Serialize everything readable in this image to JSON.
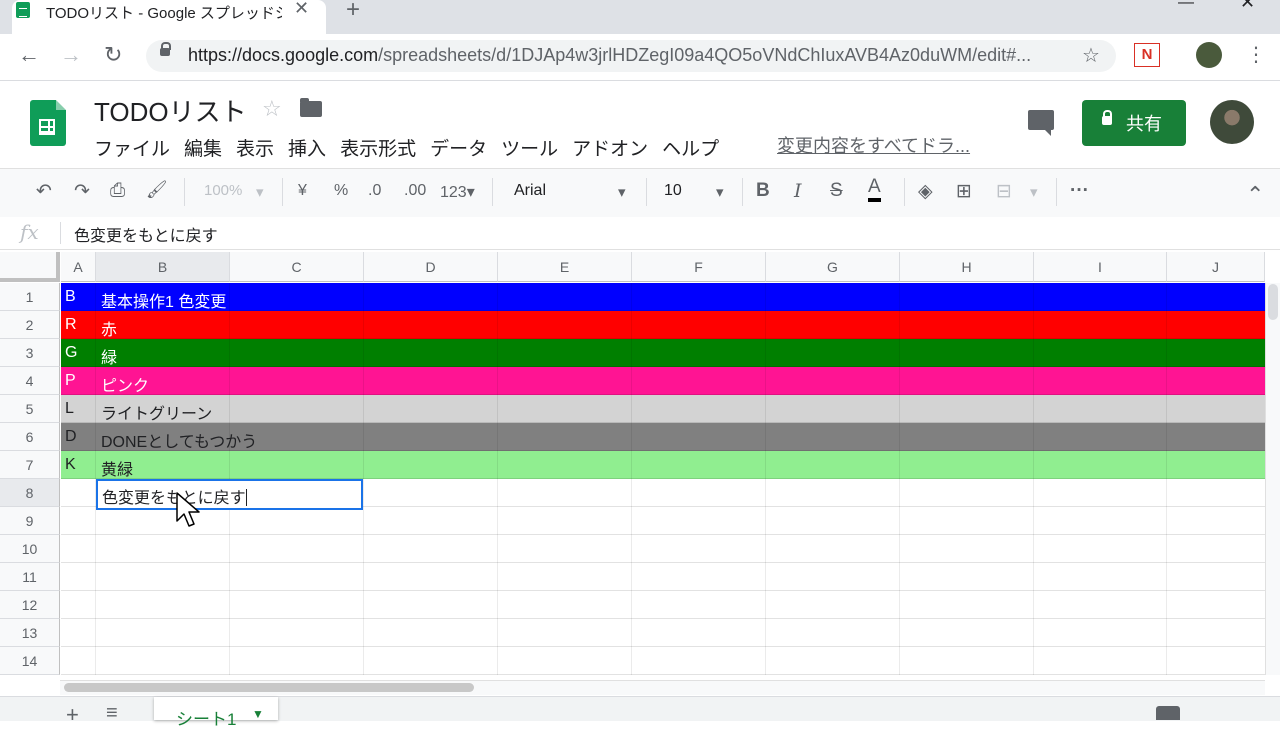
{
  "browser": {
    "tab_title": "TODOリスト - Google スプレッドシー",
    "tab_close": "✕",
    "new_tab": "+",
    "window_minimize": "—",
    "window_close": "✕",
    "back": "←",
    "forward": "→",
    "reload": "↻",
    "url_host": "https://docs.google.com",
    "url_path": "/spreadsheets/d/1DJAp4w3jrlHDZegI09a4QO5oVNdChIuxAVB4Az0duWM/edit#...",
    "star": "☆",
    "extension_label": "N",
    "menu": "⋮"
  },
  "doc": {
    "title": "TODOリスト",
    "star": "☆",
    "menus": [
      "ファイル",
      "編集",
      "表示",
      "挿入",
      "表示形式",
      "データ",
      "ツール",
      "アドオン",
      "ヘルプ"
    ],
    "last_edit": "変更内容をすべてドラ...",
    "share_label": "共有"
  },
  "toolbar": {
    "undo": "↶",
    "redo": "↷",
    "print": "⎙",
    "paint_format": "🖌",
    "zoom": "100%",
    "zoom_arrow": "▾",
    "currency": "¥",
    "percent": "%",
    "decrease_decimal": ".0",
    "increase_decimal": ".00",
    "number_format": "123▾",
    "font": "Arial",
    "font_arrow": "▾",
    "font_size": "10",
    "size_arrow": "▾",
    "bold": "B",
    "italic": "I",
    "strikethrough": "S",
    "text_color": "A",
    "fill_color": "◈",
    "borders": "⊞",
    "merge": "⊟",
    "merge_arrow": "▾",
    "more": "···",
    "collapse": "⌃"
  },
  "formula_bar": {
    "fx": "fx",
    "value": "色変更をもとに戻す"
  },
  "columns": [
    "A",
    "B",
    "C",
    "D",
    "E",
    "F",
    "G",
    "H",
    "I",
    "J"
  ],
  "selected_column": "B",
  "rows": [
    {
      "n": "1",
      "a": "B",
      "b": "基本操作1 色変更",
      "bg": "#0000ff",
      "fg": "#ffffff"
    },
    {
      "n": "2",
      "a": "R",
      "b": "赤",
      "bg": "#ff0000",
      "fg": "#ffffff"
    },
    {
      "n": "3",
      "a": "G",
      "b": "緑",
      "bg": "#007f00",
      "fg": "#ffffff"
    },
    {
      "n": "4",
      "a": "P",
      "b": "ピンク",
      "bg": "#ff1493",
      "fg": "#ffffff"
    },
    {
      "n": "5",
      "a": "L",
      "b": "ライトグリーン",
      "bg": "#d3d3d3",
      "fg": "#202124"
    },
    {
      "n": "6",
      "a": "D",
      "b": "DONEとしてもつかう",
      "bg": "#808080",
      "fg": "#202124"
    },
    {
      "n": "7",
      "a": "K",
      "b": "黄緑",
      "bg": "#90ee90",
      "fg": "#202124"
    },
    {
      "n": "8",
      "a": "",
      "b": "",
      "bg": "#ffffff",
      "fg": "#202124"
    },
    {
      "n": "9",
      "a": "",
      "b": "",
      "bg": "#ffffff",
      "fg": "#202124"
    },
    {
      "n": "10",
      "a": "",
      "b": "",
      "bg": "#ffffff",
      "fg": "#202124"
    },
    {
      "n": "11",
      "a": "",
      "b": "",
      "bg": "#ffffff",
      "fg": "#202124"
    },
    {
      "n": "12",
      "a": "",
      "b": "",
      "bg": "#ffffff",
      "fg": "#202124"
    },
    {
      "n": "13",
      "a": "",
      "b": "",
      "bg": "#ffffff",
      "fg": "#202124"
    },
    {
      "n": "14",
      "a": "",
      "b": "",
      "bg": "#ffffff",
      "fg": "#202124"
    }
  ],
  "active_cell": {
    "ref": "B8",
    "editing_text": "色変更をもとに戻す"
  },
  "sheets": {
    "add": "+",
    "all": "≡",
    "tab_label": "シート1",
    "tab_arrow": "▼"
  },
  "colors": {
    "accent": "#1a73e8",
    "share": "#188038"
  }
}
